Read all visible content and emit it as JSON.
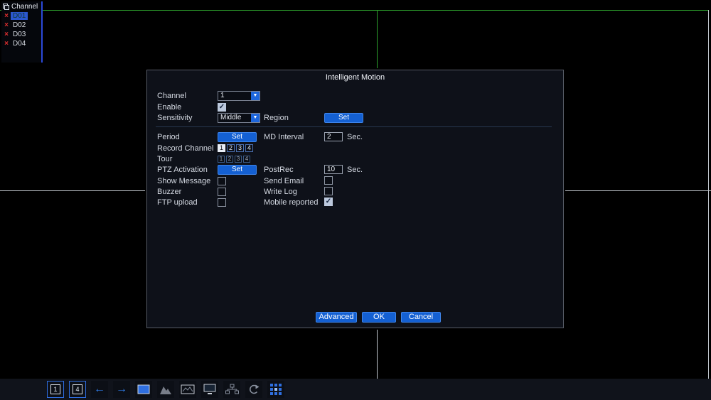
{
  "colors": {
    "accent_blue": "#1d66dc",
    "grid_green": "#2da02d",
    "grid_white": "#c0c5cc",
    "error_red": "#e03030"
  },
  "sidebar": {
    "title": "Channel",
    "items": [
      {
        "label": "D01",
        "selected": true
      },
      {
        "label": "D02",
        "selected": false
      },
      {
        "label": "D03",
        "selected": false
      },
      {
        "label": "D04",
        "selected": false
      }
    ]
  },
  "dialog": {
    "title": "Intelligent Motion",
    "channel": {
      "label": "Channel",
      "value": "1"
    },
    "enable": {
      "label": "Enable",
      "checked": true
    },
    "sensitivity": {
      "label": "Sensitivity",
      "value": "Middle"
    },
    "region": {
      "label": "Region",
      "button": "Set"
    },
    "period": {
      "label": "Period",
      "button": "Set"
    },
    "md_interval": {
      "label": "MD Interval",
      "value": "2",
      "unit": "Sec."
    },
    "record_channel": {
      "label": "Record Channel",
      "options": [
        "1",
        "2",
        "3",
        "4"
      ],
      "active": [
        true,
        false,
        false,
        false
      ]
    },
    "tour": {
      "label": "Tour",
      "options": [
        "1",
        "2",
        "3",
        "4"
      ],
      "active": [
        false,
        false,
        false,
        false
      ]
    },
    "ptz": {
      "label": "PTZ Activation",
      "button": "Set"
    },
    "postrec": {
      "label": "PostRec",
      "value": "10",
      "unit": "Sec."
    },
    "show_message": {
      "label": "Show Message",
      "checked": false
    },
    "send_email": {
      "label": "Send Email",
      "checked": false
    },
    "buzzer": {
      "label": "Buzzer",
      "checked": false
    },
    "write_log": {
      "label": "Write Log",
      "checked": false
    },
    "ftp_upload": {
      "label": "FTP upload",
      "checked": false
    },
    "mobile_reported": {
      "label": "Mobile reported",
      "checked": true
    },
    "buttons": {
      "advanced": "Advanced",
      "ok": "OK",
      "cancel": "Cancel"
    }
  },
  "toolbar": {
    "view_single": "1",
    "view_quad": "4",
    "icons": [
      "single-view",
      "quad-view",
      "prev-channel",
      "next-channel",
      "display",
      "ptz",
      "playback",
      "monitor",
      "network",
      "rotate",
      "multi-view"
    ]
  }
}
